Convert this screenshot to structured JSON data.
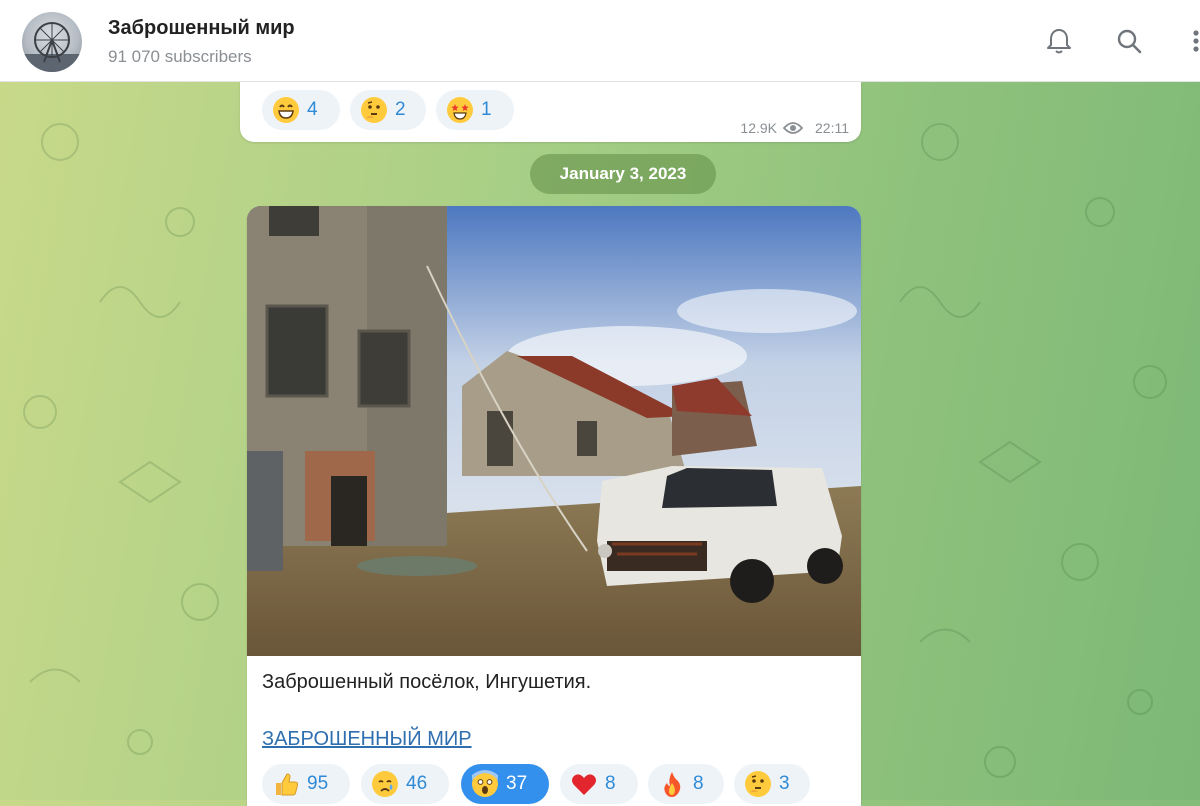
{
  "header": {
    "title": "Заброшенный мир",
    "subscribers": "91 070 subscribers",
    "icons": [
      "bell-icon",
      "search-icon",
      "more-icon"
    ]
  },
  "prev_post": {
    "reactions": [
      {
        "emoji": "grinning-face",
        "count": "4"
      },
      {
        "emoji": "thinking-face",
        "count": "2"
      },
      {
        "emoji": "star-struck-face",
        "count": "1"
      }
    ],
    "views": "12.9K",
    "time": "22:11"
  },
  "date_separator": "January 3, 2023",
  "post": {
    "caption": "Заброшенный посёлок, Ингушетия.",
    "link": "ЗАБРОШЕННЫЙ МИР",
    "reactions": [
      {
        "emoji": "thumbs-up",
        "count": "95"
      },
      {
        "emoji": "crying-face",
        "count": "46"
      },
      {
        "emoji": "screaming-face",
        "count": "37",
        "selected": true
      },
      {
        "emoji": "red-heart",
        "count": "8"
      },
      {
        "emoji": "fire",
        "count": "8"
      },
      {
        "emoji": "thinking-face",
        "count": "3"
      }
    ]
  },
  "colors": {
    "accent": "#3390ec",
    "link": "#2f6fb0",
    "reaction_bg": "#eef3f8",
    "muted": "#8a8f94"
  }
}
